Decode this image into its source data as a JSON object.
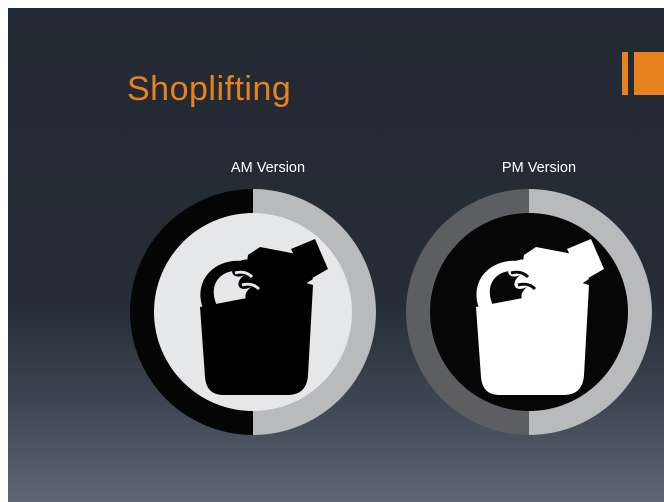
{
  "slide": {
    "title": "Shoplifting",
    "versions": [
      {
        "label": "AM Version",
        "icon": "shoplifting-bag-icon"
      },
      {
        "label": "PM Version",
        "icon": "shoplifting-bag-icon"
      }
    ]
  },
  "colors": {
    "accent": "#e8821e",
    "background_top": "#222932",
    "background_bottom": "#5e6773"
  }
}
